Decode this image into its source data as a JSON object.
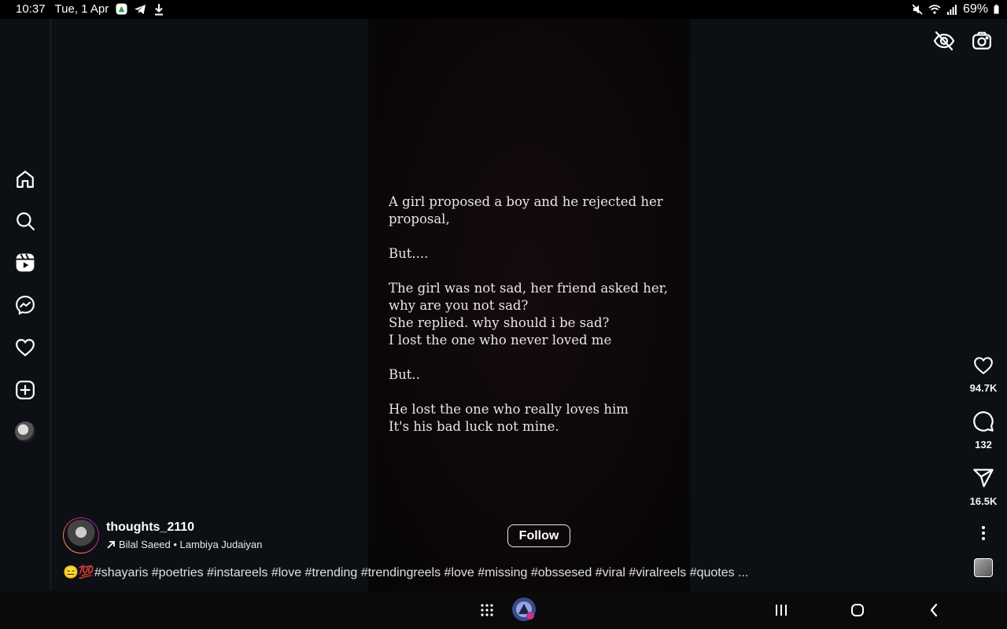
{
  "status_bar": {
    "time": "10:37",
    "date": "Tue, 1 Apr",
    "battery": "69%"
  },
  "reel": {
    "text": "A girl proposed a boy and he rejected her proposal,\n\nBut....\n\nThe girl was not sad, her friend asked her, why are you not sad?\nShe replied. why should i be sad?\nI lost the one who never loved me\n\nBut..\n\nHe lost the one who really loves him\nIt's his bad luck not mine."
  },
  "actions": {
    "likes": "94.7K",
    "comments": "132",
    "shares": "16.5K"
  },
  "owner": {
    "username": "thoughts_2110",
    "audio": "Bilal Saeed • Lambiya Judaiyan",
    "follow_label": "Follow"
  },
  "caption": "😑💯#shayaris #poetries #instareels #love #trending #trendingreels #love #missing #obssesed #viral #viralreels #quotes ...",
  "icons": {
    "sidebar": [
      "home-icon",
      "search-icon",
      "reels-icon",
      "messenger-icon",
      "heart-icon",
      "create-icon",
      "profile-avatar"
    ],
    "top": [
      "eye-off-icon",
      "camera-icon"
    ]
  }
}
